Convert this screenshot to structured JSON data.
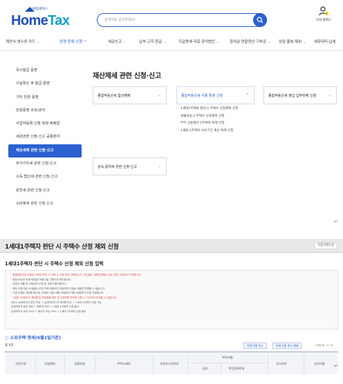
{
  "shot1": {
    "logo": {
      "sub": "국세청홈택스",
      "main_a": "Home",
      "main_b": "Tax"
    },
    "search": {
      "placeholder": "검색어를 입력하세요!"
    },
    "user_label": "나의 홈택스",
    "gnb": [
      {
        "label": "계산서·영수증·카드",
        "active": false
      },
      {
        "label": "증명·등록·신청",
        "active": true
      },
      {
        "label": "세금신고",
        "active": false
      },
      {
        "label": "납부·고지·환급",
        "active": false
      },
      {
        "label": "지급명세·자료·공익법인",
        "active": false
      },
      {
        "label": "장려금·연말정산·기부금",
        "active": false
      },
      {
        "label": "상담·불복·제보",
        "active": false
      },
      {
        "label": "세무대리·납세",
        "active": false
      }
    ],
    "lnb": [
      {
        "label": "즉시발급 증명",
        "active": false
      },
      {
        "label": "사실확인 후 발급 증명",
        "active": false
      },
      {
        "label": "기타 민원 증명",
        "active": false
      },
      {
        "label": "민원증명 조회/관리",
        "active": false
      },
      {
        "label": "사업자등록 신청·정정·휴폐업",
        "active": false
      },
      {
        "label": "세금관련 신청·신고 공통분야",
        "active": false
      },
      {
        "label": "재산세제 관련 신청·신고",
        "active": true
      },
      {
        "label": "부가가치세 관련 신청·신고",
        "active": false
      },
      {
        "label": "소득·법인세 관련 신청·신고",
        "active": false
      },
      {
        "label": "원천세 관련 신청·신고",
        "active": false
      },
      {
        "label": "소비제세 관련 신청·신고",
        "active": false
      }
    ],
    "content_title": "재산제세 관련 신청·신고",
    "cards": {
      "c1": "종합부동산세 합산배제",
      "c2": "종합부동산세 각종 특례 신청",
      "c3": "종합부동산세 분납 납부유예 신청",
      "c4": "상속·증여세 관련 신청·신고"
    },
    "sub_items": [
      "· 1세대1주택자 판단시 주택수 산정제외 신청",
      "· 세율적용시 주택수 산정제외 신청",
      "· 부부 공동명의 1주택자 특례 신청",
      "· 1세대 1주택자 보유기간 계산 특례 신청"
    ]
  },
  "shot2": {
    "title": "1세대1주택자 판단 시 주택수 산정 제외 신청",
    "print_label": "이용자매뉴얼",
    "subtitle": "1세대1주택자 판단 시 주택수 산정 제외 신청 입력",
    "notice_lines": [
      "· 종합부동산세 1세대1주택자 판단 시 주택 수 산정 제외 신청하시고, 기산정된 사항에 변동이 있는 경우 신청하시기 바랍니다.",
      "· 법정 요건과 과세기준일인 6월 1일 기준으로 판단됩니다.",
      "· 신청서 제출 후 신청내역 수정 및 삭제가 불가합니다.",
      "· 해당 신청기한 내 제출된 신청 건에 대해서만 반영되며 신청된 내용은 변경할 수 없습니다.",
      "· 기준 신청은 세대원 확인된 1세대는 매년 9월 16일부터 9월 30일까지 신청 가능합니다.",
      "· 1세대 1주택자의 세대원 등 보유현황 확인 후 신청하며 부적정 신청 시 가산세가 부과될 수 있습니다.",
      "(예시) 납세의무자 본인 보유 + 납세의무자 외 세대원 보유 = 1세대 1주택자 신청 가능",
      "      납세의무자 본인 보유 + 배우자 보유 = 1세대 1주택자 신청 불가",
      "      납세의무자 보유 50% + 배우자 보유 50% = 1세대 1주택자 신청 불가"
    ],
    "section_title": "○ 소유주택 명세(6월1일기준)",
    "count_label": "총 0건",
    "buttons": {
      "b1": "특례 적용 취소",
      "b2": "특례 적용 취소 해제"
    },
    "note": "(단위:원, ㎡, %)",
    "headers": {
      "h1": "신청구분",
      "h2": "신청제외",
      "h3": "건물유형",
      "h4": "주택소재지",
      "h5": "부동산고유번호",
      "h6": "취득비율",
      "h6a": "신청",
      "h6b": "주민등록번호",
      "h7": "공시지가",
      "h8": "상속비율"
    }
  },
  "colors": {
    "accent": "#2a60d0",
    "logo_blue": "#1d4fb8",
    "logo_teal": "#14a0c8"
  }
}
